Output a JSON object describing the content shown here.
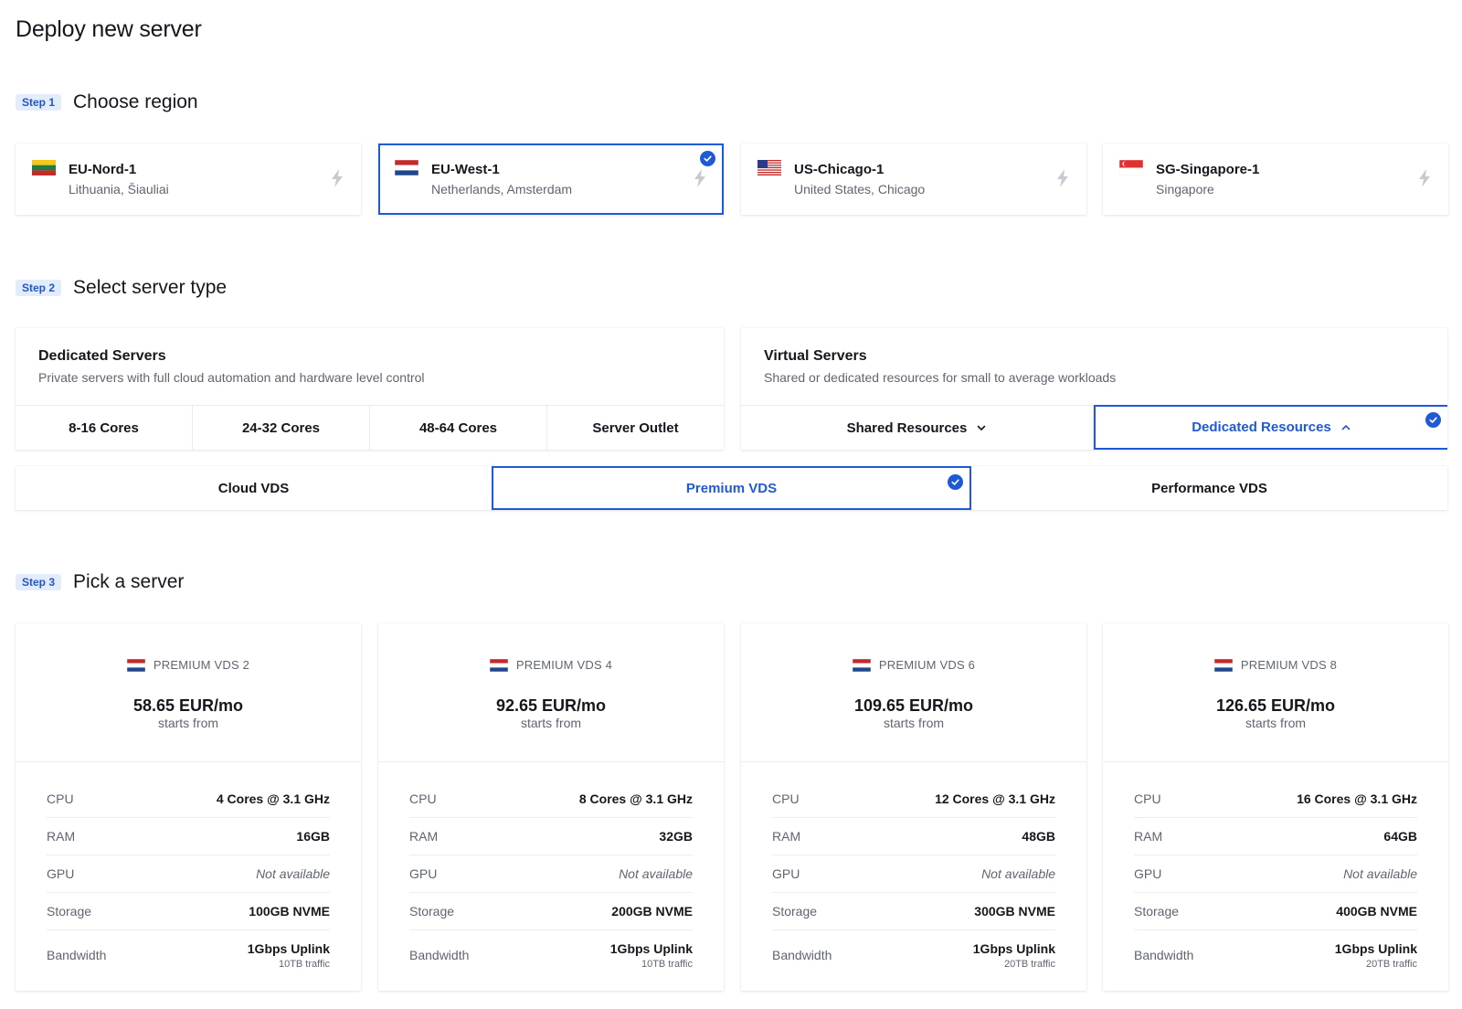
{
  "page_title": "Deploy new server",
  "colors": {
    "accent": "#1f5ad6",
    "badge_bg": "#e3ecfb"
  },
  "steps": [
    {
      "badge": "Step 1",
      "title": "Choose region"
    },
    {
      "badge": "Step 2",
      "title": "Select server type"
    },
    {
      "badge": "Step 3",
      "title": "Pick a server"
    }
  ],
  "regions": [
    {
      "name": "EU-Nord-1",
      "location": "Lithuania, Šiauliai",
      "flag": "lithuania-flag-icon"
    },
    {
      "name": "EU-West-1",
      "location": "Netherlands, Amsterdam",
      "flag": "netherlands-flag-icon",
      "selected": true
    },
    {
      "name": "US-Chicago-1",
      "location": "United States, Chicago",
      "flag": "usa-flag-icon"
    },
    {
      "name": "SG-Singapore-1",
      "location": "Singapore",
      "flag": "singapore-flag-icon"
    }
  ],
  "dedicated": {
    "title": "Dedicated Servers",
    "description": "Private servers with full cloud automation and hardware level control",
    "options": [
      "8-16 Cores",
      "24-32 Cores",
      "48-64 Cores",
      "Server Outlet"
    ]
  },
  "virtual": {
    "title": "Virtual Servers",
    "description": "Shared or dedicated resources for small to average workloads",
    "options": [
      "Shared Resources",
      "Dedicated Resources"
    ]
  },
  "vds_types": [
    "Cloud VDS",
    "Premium VDS",
    "Performance VDS"
  ],
  "spec_labels": [
    "CPU",
    "RAM",
    "GPU",
    "Storage",
    "Bandwidth"
  ],
  "servers": [
    {
      "plan": "PREMIUM VDS 2",
      "price": "58.65 EUR/mo",
      "price_note": "starts from",
      "cpu": "4 Cores @ 3.1 GHz",
      "ram": "16GB",
      "gpu": "Not available",
      "storage": "100GB NVME",
      "bandwidth": "1Gbps Uplink",
      "traffic": "10TB traffic"
    },
    {
      "plan": "PREMIUM VDS 4",
      "price": "92.65 EUR/mo",
      "price_note": "starts from",
      "cpu": "8 Cores @ 3.1 GHz",
      "ram": "32GB",
      "gpu": "Not available",
      "storage": "200GB NVME",
      "bandwidth": "1Gbps Uplink",
      "traffic": "10TB traffic"
    },
    {
      "plan": "PREMIUM VDS 6",
      "price": "109.65 EUR/mo",
      "price_note": "starts from",
      "cpu": "12 Cores @ 3.1 GHz",
      "ram": "48GB",
      "gpu": "Not available",
      "storage": "300GB NVME",
      "bandwidth": "1Gbps Uplink",
      "traffic": "20TB traffic"
    },
    {
      "plan": "PREMIUM VDS 8",
      "price": "126.65 EUR/mo",
      "price_note": "starts from",
      "cpu": "16 Cores @ 3.1 GHz",
      "ram": "64GB",
      "gpu": "Not available",
      "storage": "400GB NVME",
      "bandwidth": "1Gbps Uplink",
      "traffic": "20TB traffic"
    }
  ]
}
